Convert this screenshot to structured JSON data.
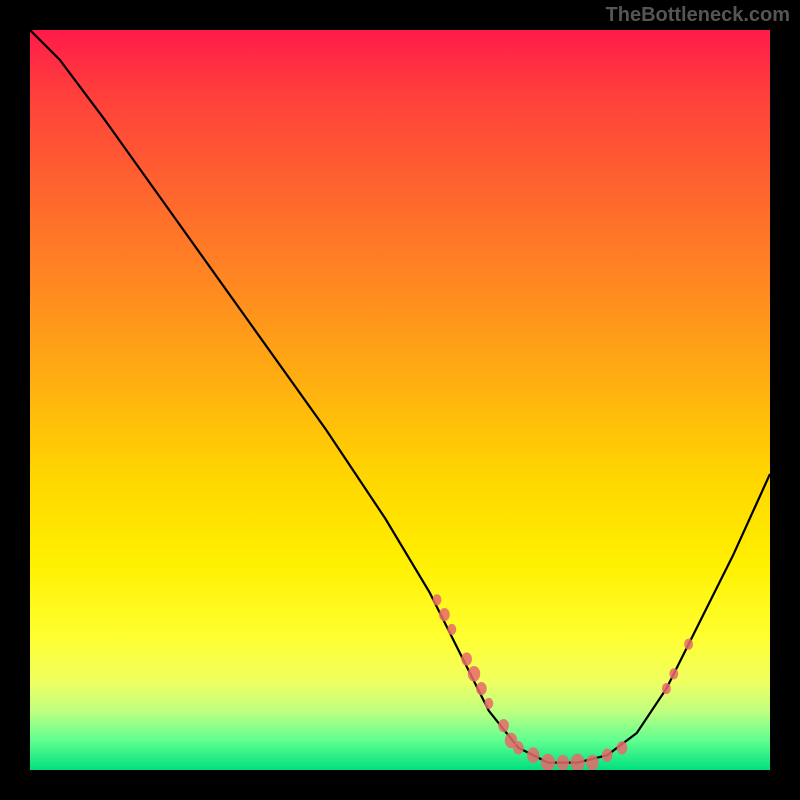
{
  "watermark": "TheBottleneck.com",
  "chart_data": {
    "type": "line",
    "title": "",
    "xlabel": "",
    "ylabel": "",
    "xlim": [
      0,
      100
    ],
    "ylim": [
      0,
      100
    ],
    "curve_points": [
      {
        "x": 0,
        "y": 100
      },
      {
        "x": 4,
        "y": 96
      },
      {
        "x": 10,
        "y": 88
      },
      {
        "x": 20,
        "y": 74
      },
      {
        "x": 30,
        "y": 60
      },
      {
        "x": 40,
        "y": 46
      },
      {
        "x": 48,
        "y": 34
      },
      {
        "x": 54,
        "y": 24
      },
      {
        "x": 58,
        "y": 16
      },
      {
        "x": 62,
        "y": 8
      },
      {
        "x": 66,
        "y": 3
      },
      {
        "x": 70,
        "y": 1
      },
      {
        "x": 74,
        "y": 1
      },
      {
        "x": 78,
        "y": 2
      },
      {
        "x": 82,
        "y": 5
      },
      {
        "x": 86,
        "y": 11
      },
      {
        "x": 90,
        "y": 19
      },
      {
        "x": 95,
        "y": 29
      },
      {
        "x": 100,
        "y": 40
      }
    ],
    "marker_clusters": [
      {
        "x": 55,
        "y": 23,
        "size": 5
      },
      {
        "x": 56,
        "y": 21,
        "size": 6
      },
      {
        "x": 57,
        "y": 19,
        "size": 5
      },
      {
        "x": 59,
        "y": 15,
        "size": 6
      },
      {
        "x": 60,
        "y": 13,
        "size": 7
      },
      {
        "x": 61,
        "y": 11,
        "size": 6
      },
      {
        "x": 62,
        "y": 9,
        "size": 5
      },
      {
        "x": 64,
        "y": 6,
        "size": 6
      },
      {
        "x": 65,
        "y": 4,
        "size": 7
      },
      {
        "x": 66,
        "y": 3,
        "size": 6
      },
      {
        "x": 68,
        "y": 2,
        "size": 7
      },
      {
        "x": 70,
        "y": 1,
        "size": 8
      },
      {
        "x": 72,
        "y": 1,
        "size": 7
      },
      {
        "x": 74,
        "y": 1,
        "size": 8
      },
      {
        "x": 76,
        "y": 1,
        "size": 7
      },
      {
        "x": 78,
        "y": 2,
        "size": 6
      },
      {
        "x": 80,
        "y": 3,
        "size": 6
      },
      {
        "x": 86,
        "y": 11,
        "size": 5
      },
      {
        "x": 87,
        "y": 13,
        "size": 5
      },
      {
        "x": 89,
        "y": 17,
        "size": 5
      }
    ],
    "colors": {
      "curve": "#000000",
      "markers": "#e86a6a",
      "background_top": "#ff1a4a",
      "background_bottom": "#00e080"
    }
  }
}
